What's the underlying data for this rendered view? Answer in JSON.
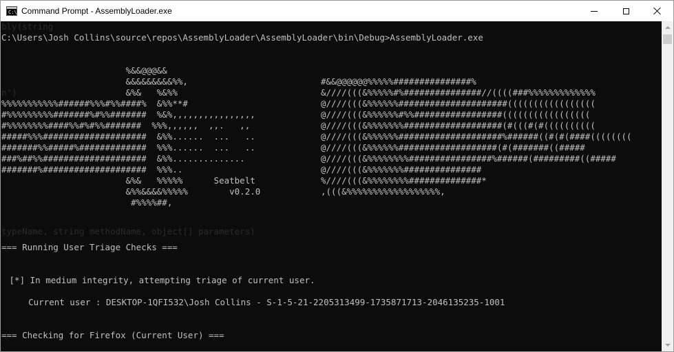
{
  "window": {
    "title": "Command Prompt - AssemblyLoader.exe",
    "icon_text": "C:\\_"
  },
  "console": {
    "prompt_line": "C:\\Users\\Josh Collins\\source\\repos\\AssemblyLoader\\AssemblyLoader\\bin\\Debug>AssemblyLoader.exe",
    "ghost_top": "bly(string",
    "ghost_left": "n\")",
    "ghost_mid": "typeName, string methodName, object[] parameters)",
    "banner_left": [
      "                        %&&@@@&&",
      "                        &&&&&&&&&%%,",
      "                        &%&   %&%%",
      "%%%%%%%%%%%######%%%#%%####%  &%%**#",
      "#%%%%%%%%%#######%#%%#######  %&%,,,,,,,,,,,,,,,,",
      "#%%%%%%%%####%%#%#%%#######  %%%,,,,,,  ,,.   ,,",
      "#####%%%####################  &%%......  ...   ..",
      "#######%%#####%#############  %%%......  ...   ..",
      "###%##%%####################  &%%..............",
      "#######%####################  %%%..",
      "                        &%&   %%%%%      Seatbelt",
      "                        &%%&&&&%%%%%        v0.2.0",
      "                         #%%%%##,"
    ],
    "banner_right": [
      "#&&@@@@@@%%%%%###############%",
      "&////(((&%%%%%#%###############//((((###%%%%%%%%%%%%%",
      "@////(((&%%%%%%#####################(((((((((((((((((",
      "@////(((&%%%%%%#%%#################(((((((((((((((((",
      "@////(((&%%%%%%%###################(#(((#(#((((((((((",
      "@////(((&%%%%%%####################%######((#(#(####((((((((",
      "@////(((&%%%%%%###################(#(#######((#####",
      "@////(((&%%%%%%%%################%######(#########((#####",
      "@////(((&%%%%%%%###############",
      "%////(((&%%%%%%%%##############*",
      ",(((&%%%%%%%%%%%%%%%%%%,"
    ],
    "section_user_triage": "=== Running User Triage Checks ===",
    "integrity_line": " [*] In medium integrity, attempting triage of current user.",
    "current_user_line": "    Current user : DESKTOP-1QFI532\\Josh Collins - S-1-5-21-2205313499-1735871713-2046135235-1001",
    "section_firefox": "=== Checking for Firefox (Current User) ==="
  },
  "colors": {
    "console_bg": "#0c0c0c",
    "console_fg": "#c0c0c0",
    "titlebar_bg": "#ffffff"
  }
}
